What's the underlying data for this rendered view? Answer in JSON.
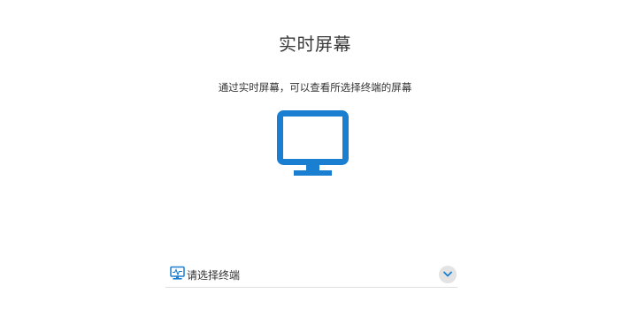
{
  "page": {
    "title": "实时屏幕",
    "subtitle": "通过实时屏幕，可以查看所选择终端的屏幕"
  },
  "hero_icon": {
    "name": "monitor-icon",
    "color": "#1a7fd1"
  },
  "terminal_select": {
    "placeholder": "请选择终端",
    "icon": "terminal-monitor-icon",
    "dropdown_icon": "chevron-down-icon",
    "accent": "#1a7fd1"
  }
}
